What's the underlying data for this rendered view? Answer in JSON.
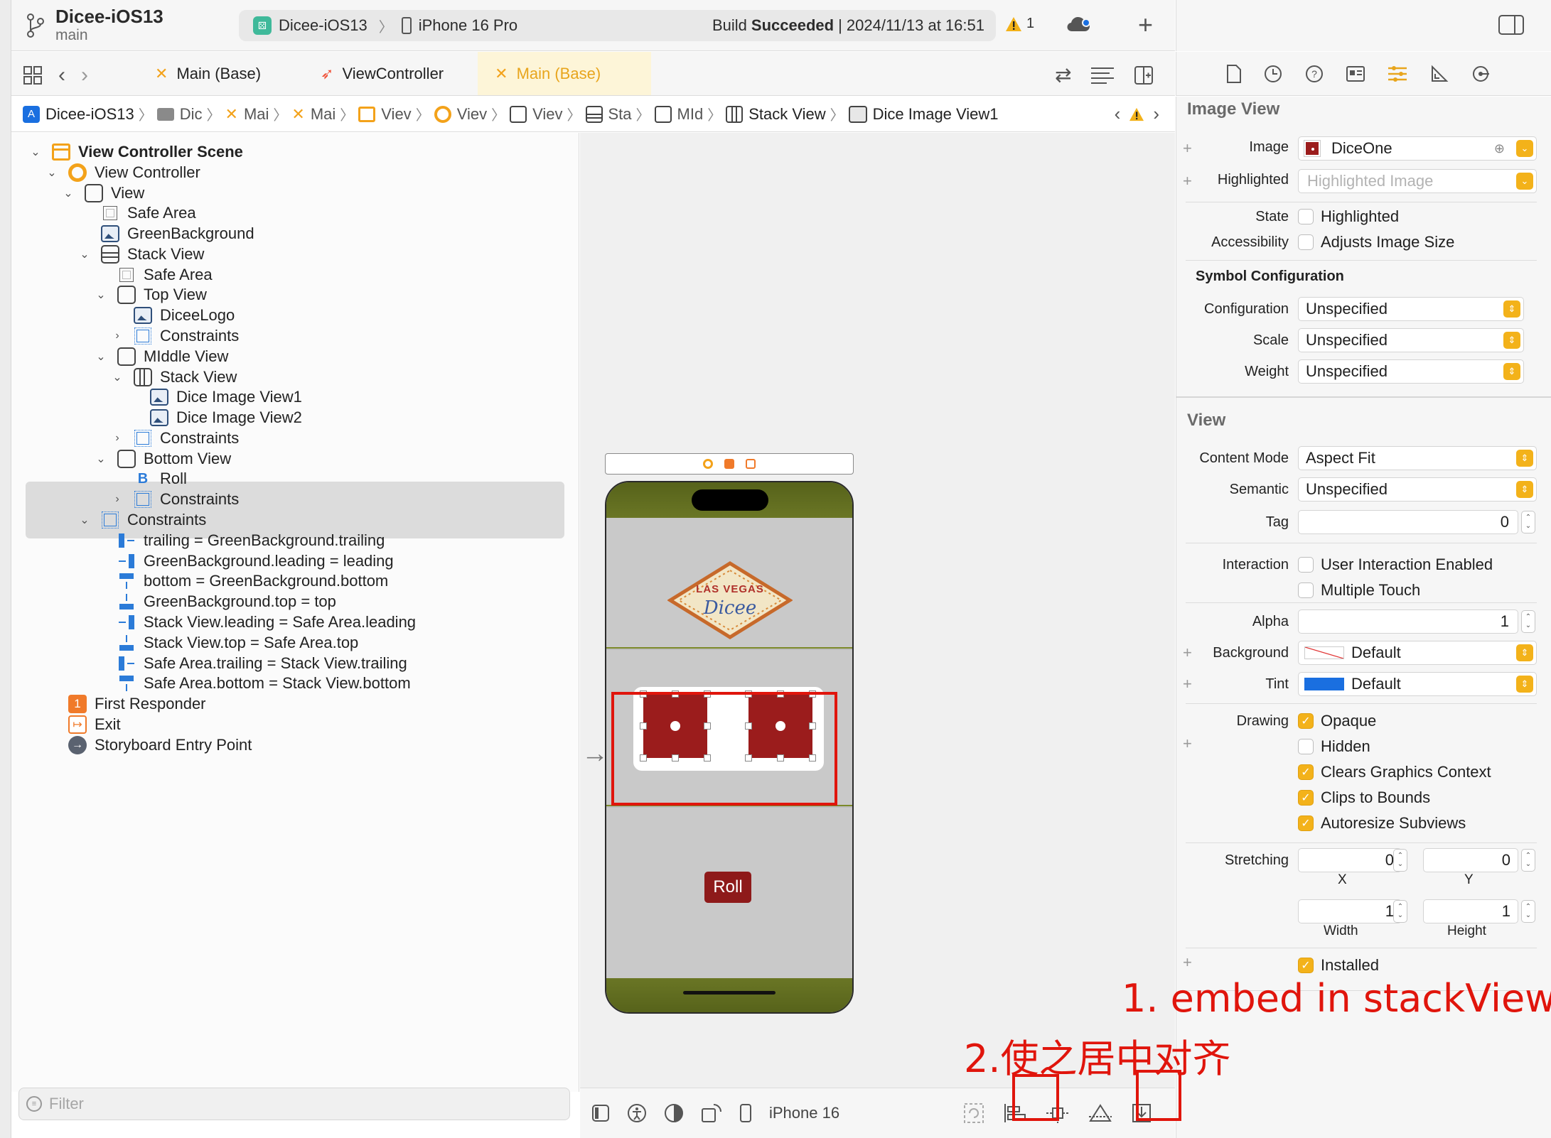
{
  "project": {
    "name": "Dicee-iOS13",
    "branch": "main"
  },
  "run_pill": {
    "scheme": "Dicee-iOS13",
    "device": "iPhone 16 Pro",
    "status_prefix": "Build",
    "status_bold": "Succeeded",
    "status_time": "| 2024/11/13 at 16:51",
    "warning_count": "1"
  },
  "tabs": [
    {
      "label": "Main (Base)",
      "active": false
    },
    {
      "label": "ViewController",
      "active": false
    },
    {
      "label": "Main (Base)",
      "active": true
    }
  ],
  "jumpbar": [
    "Dicee-iOS13",
    "Dic",
    "Mai",
    "Mai",
    "Viev",
    "Viev",
    "Viev",
    "Sta",
    "MId",
    "Stack View",
    "Dice Image View1"
  ],
  "outline": {
    "items": [
      {
        "label": "View Controller Scene",
        "icon": "scene-icon",
        "bold": true
      },
      {
        "label": "View Controller",
        "icon": "view-controller-icon"
      },
      {
        "label": "View",
        "icon": "view-icon"
      },
      {
        "label": "Safe Area",
        "icon": "safe-area-icon"
      },
      {
        "label": "GreenBackground",
        "icon": "image-view-icon"
      },
      {
        "label": "Stack View",
        "icon": "vertical-stack-icon"
      },
      {
        "label": "Safe Area",
        "icon": "safe-area-icon"
      },
      {
        "label": "Top View",
        "icon": "view-icon"
      },
      {
        "label": "DiceeLogo",
        "icon": "image-view-icon"
      },
      {
        "label": "Constraints",
        "icon": "constraints-icon"
      },
      {
        "label": "MIddle View",
        "icon": "view-icon"
      },
      {
        "label": "Stack View",
        "icon": "horizontal-stack-icon"
      },
      {
        "label": "Dice Image View1",
        "icon": "image-view-icon",
        "selected": true
      },
      {
        "label": "Dice Image View2",
        "icon": "image-view-icon",
        "selected": true
      },
      {
        "label": "Constraints",
        "icon": "constraints-icon"
      },
      {
        "label": "Bottom View",
        "icon": "view-icon"
      },
      {
        "label": "Roll",
        "icon": "button-icon"
      },
      {
        "label": "Constraints",
        "icon": "constraints-icon"
      },
      {
        "label": "Constraints",
        "icon": "constraints-icon"
      },
      {
        "label": "trailing = GreenBackground.trailing",
        "icon": "constraint-trailing-icon"
      },
      {
        "label": "GreenBackground.leading = leading",
        "icon": "constraint-leading-icon"
      },
      {
        "label": "bottom = GreenBackground.bottom",
        "icon": "constraint-bottom-icon"
      },
      {
        "label": "GreenBackground.top = top",
        "icon": "constraint-top-icon"
      },
      {
        "label": "Stack View.leading = Safe Area.leading",
        "icon": "constraint-leading-icon"
      },
      {
        "label": "Stack View.top = Safe Area.top",
        "icon": "constraint-top-icon"
      },
      {
        "label": "Safe Area.trailing = Stack View.trailing",
        "icon": "constraint-trailing-icon"
      },
      {
        "label": "Safe Area.bottom = Stack View.bottom",
        "icon": "constraint-bottom-icon"
      },
      {
        "label": "First Responder",
        "icon": "first-responder-icon"
      },
      {
        "label": "Exit",
        "icon": "exit-icon"
      },
      {
        "label": "Storyboard Entry Point",
        "icon": "entry-point-icon"
      }
    ],
    "filter_placeholder": "Filter"
  },
  "canvas": {
    "logo_line1": "LAS VEGAS",
    "logo_line2": "Dicee",
    "roll_button": "Roll",
    "device_label": "iPhone 16",
    "colors": {
      "felt_green": "#5f6b1c",
      "dice_red": "#9b1c1c",
      "phone_gray": "#bdbdbd"
    }
  },
  "inspector": {
    "image_view_header": "Image View",
    "image_label": "Image",
    "image_value": "DiceOne",
    "highlighted_label": "Highlighted",
    "highlighted_placeholder": "Highlighted Image",
    "state_label": "State",
    "state_option": "Highlighted",
    "accessibility_label": "Accessibility",
    "accessibility_option": "Adjusts Image Size",
    "symbol_header": "Symbol Configuration",
    "configuration_label": "Configuration",
    "configuration_value": "Unspecified",
    "scale_label": "Scale",
    "scale_value": "Unspecified",
    "weight_label": "Weight",
    "weight_value": "Unspecified",
    "view_header": "View",
    "content_mode_label": "Content Mode",
    "content_mode_value": "Aspect Fit",
    "semantic_label": "Semantic",
    "semantic_value": "Unspecified",
    "tag_label": "Tag",
    "tag_value": "0",
    "interaction_label": "Interaction",
    "user_interaction": "User Interaction Enabled",
    "multiple_touch": "Multiple Touch",
    "alpha_label": "Alpha",
    "alpha_value": "1",
    "background_label": "Background",
    "background_value": "Default",
    "tint_label": "Tint",
    "tint_value": "Default",
    "tint_color": "#1a6fe0",
    "drawing_label": "Drawing",
    "opaque": "Opaque",
    "hidden": "Hidden",
    "clears": "Clears Graphics Context",
    "clips": "Clips to Bounds",
    "autoresize": "Autoresize Subviews",
    "stretching_label": "Stretching",
    "stretch_x": "0",
    "stretch_y": "0",
    "stretch_w": "1",
    "stretch_h": "1",
    "x_label": "X",
    "y_label": "Y",
    "width_label": "Width",
    "height_label": "Height",
    "installed": "Installed"
  },
  "annotations": {
    "note1": "1. embed in stackView",
    "note2": "2.使之居中对齐",
    "color": "#e0150c"
  }
}
